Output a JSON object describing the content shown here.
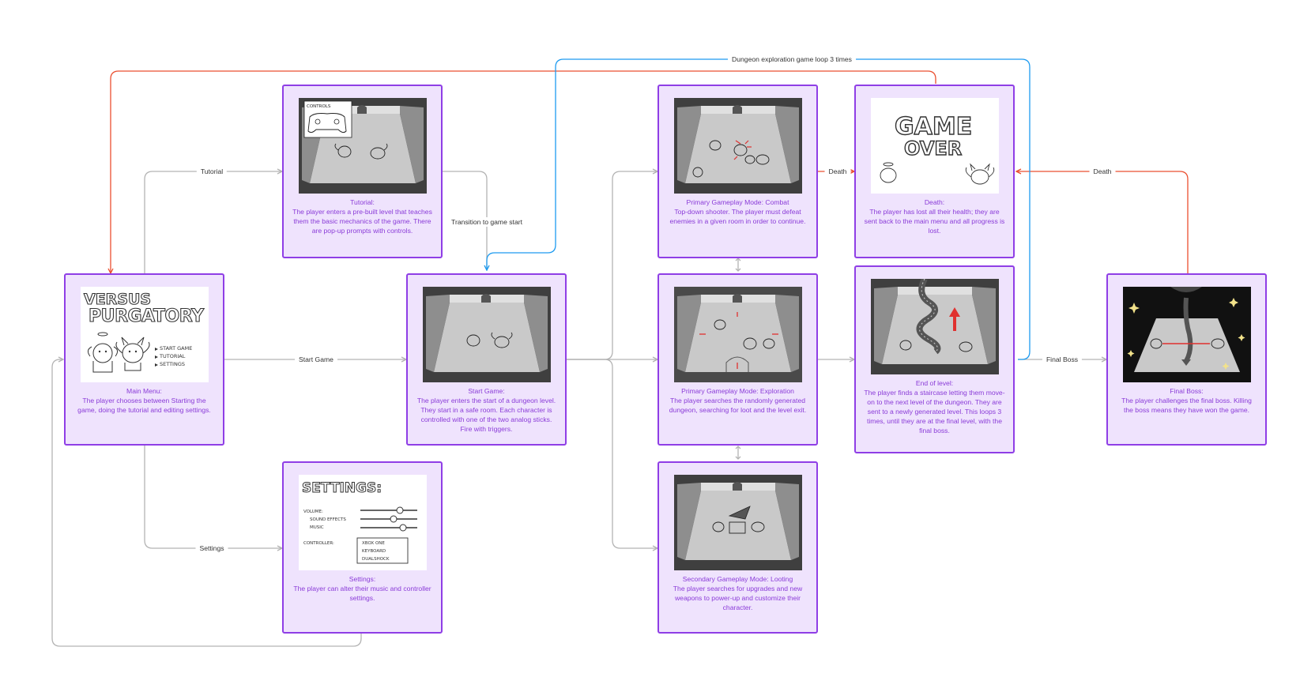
{
  "cards": {
    "main_menu": {
      "title": "Main Menu:",
      "body": "The player chooses between Starting the game, doing the tutorial and editing settings.",
      "art": {
        "line1": "VERSUS",
        "line2": "PURGATORY",
        "menu": [
          "START GAME",
          "TUTORIAL",
          "SETTINGS"
        ]
      }
    },
    "tutorial": {
      "title": "Tutorial:",
      "body": "The player enters a pre-built level that teaches them the basic mechanics of the game. There are pop-up prompts with controls.",
      "art": {
        "popup": "CONTROLS"
      }
    },
    "settings": {
      "title": "Settings:",
      "body": "The player can alter their music and controller settings.",
      "art": {
        "heading": "SETTINGS:",
        "volume": "VOLUME:",
        "sfx": "SOUND EFFECTS",
        "music": "MUSIC",
        "controller": "CONTROLLER:",
        "options": [
          "XBOX ONE",
          "KEYBOARD",
          "DUALSHOCK"
        ]
      }
    },
    "start_game": {
      "title": "Start Game:",
      "body": "The player enters the start of a dungeon level. They start in a safe room. Each character is controlled with one of the two analog sticks. Fire with triggers."
    },
    "combat": {
      "title": "Primary Gameplay Mode: Combat",
      "body": "Top-down shooter. The player must defeat enemies in a given room in order to continue."
    },
    "exploration": {
      "title": "Primary Gameplay Mode: Exploration",
      "body": "The player searches the randomly generated dungeon, searching for loot and the level exit."
    },
    "looting": {
      "title": "Secondary Gameplay Mode: Looting",
      "body": "The player searches for upgrades and new weapons to power-up and customize their character."
    },
    "death": {
      "title": "Death:",
      "body": "The player has lost all their health; they are sent back to the main menu and all progress is lost.",
      "art": {
        "line1": "GAME",
        "line2": "OVER"
      }
    },
    "end_level": {
      "title": "End of level:",
      "body": "The player finds a staircase letting them move-on to the next level of the dungeon. They are sent to a newly generated level. This loops 3 times, until they are at the final level, with the final boss."
    },
    "final_boss": {
      "title": "Final Boss:",
      "body": "The player challenges the final boss. Killing the boss means they have won the game."
    }
  },
  "edges": {
    "tutorial": "Tutorial",
    "start_game": "Start Game",
    "settings": "Settings",
    "transition": "Transition to game start",
    "loop": "Dungeon exploration game loop 3 times",
    "death1": "Death",
    "death2": "Death",
    "final_boss": "Final Boss"
  },
  "colors": {
    "card_fill": "#efe3fd",
    "card_border": "#8f3ee6",
    "caption_text": "#8a3bd8",
    "flow_gray": "#b3b3b3",
    "death_red": "#ea4f30",
    "loop_blue": "#1d9bf0",
    "art_dark": "#3f3f3f"
  }
}
